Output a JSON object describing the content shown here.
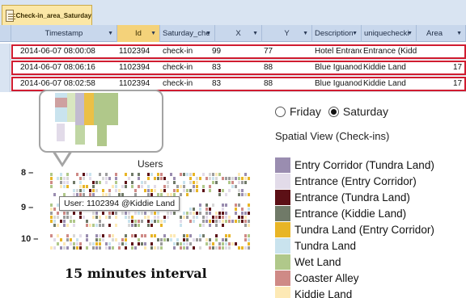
{
  "window": {
    "tab_label": "Check-in_area_Saturday",
    "columns": [
      "Timestamp",
      "Id",
      "Saturday_che",
      "X",
      "Y",
      "Description",
      "uniquechecki",
      "Area"
    ],
    "rows": [
      [
        "2014-06-07 08:00:08",
        "1102394",
        "check-in",
        "99",
        "77",
        "Hotel Entrance",
        "Entrance (Kiddie",
        ""
      ],
      [
        "2014-06-07 08:06:16",
        "1102394",
        "check-in",
        "83",
        "88",
        "Blue Iguanodon",
        "Kiddie Land",
        "17"
      ],
      [
        "2014-06-07 08:02:58",
        "1102394",
        "check-in",
        "83",
        "88",
        "Blue Iguanodon",
        "Kiddie Land",
        "17"
      ]
    ]
  },
  "heatmap": {
    "title": "Users",
    "row_labels": [
      "8 –",
      "9 –",
      "10 –"
    ],
    "tooltip": "User: 1102394 @Kiddie Land",
    "interval_label": "15 minutes interval"
  },
  "panel": {
    "options": [
      {
        "label": "Friday",
        "selected": false
      },
      {
        "label": "Saturday",
        "selected": true
      }
    ],
    "title": "Spatial View (Check-ins)",
    "legend": [
      {
        "label": "Entry Corridor (Tundra Land)",
        "color": "#9a8db0"
      },
      {
        "label": "Entrance (Entry Corridor)",
        "color": "#e2dbe9"
      },
      {
        "label": "Entrance (Tundra Land)",
        "color": "#5c1016"
      },
      {
        "label": "Entrance (Kiddie Land)",
        "color": "#707a68"
      },
      {
        "label": "Tundra Land (Entry Corridor)",
        "color": "#e8b526"
      },
      {
        "label": "Tundra Land",
        "color": "#c9e3ee"
      },
      {
        "label": "Wet Land",
        "color": "#b0c88a"
      },
      {
        "label": "Coaster Alley",
        "color": "#cf8a86"
      },
      {
        "label": "Kiddie Land",
        "color": "#fde9b5"
      }
    ]
  }
}
